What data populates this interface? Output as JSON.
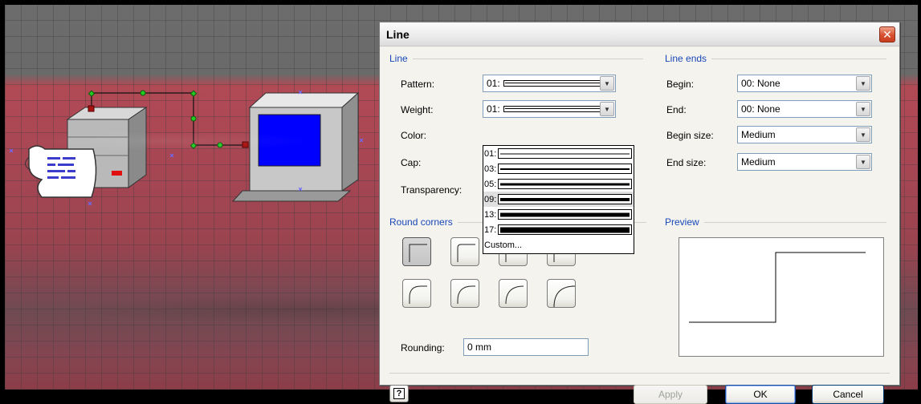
{
  "dialog": {
    "title": "Line",
    "line_group": {
      "title": "Line",
      "pattern_label": "Pattern:",
      "pattern_value": "01:",
      "weight_label": "Weight:",
      "weight_value": "01:",
      "color_label": "Color:",
      "cap_label": "Cap:",
      "transparency_label": "Transparency:"
    },
    "weight_dropdown": {
      "items": [
        {
          "label": "01:",
          "thickness": 1
        },
        {
          "label": "03:",
          "thickness": 2
        },
        {
          "label": "05:",
          "thickness": 3
        },
        {
          "label": "09:",
          "thickness": 4,
          "selected": true
        },
        {
          "label": "13:",
          "thickness": 5
        },
        {
          "label": "17:",
          "thickness": 7
        }
      ],
      "custom_label": "Custom..."
    },
    "line_ends": {
      "title": "Line ends",
      "begin_label": "Begin:",
      "begin_value": "00: None",
      "end_label": "End:",
      "end_value": "00: None",
      "begin_size_label": "Begin size:",
      "begin_size_value": "Medium",
      "end_size_label": "End size:",
      "end_size_value": "Medium"
    },
    "round_corners": {
      "title": "Round corners",
      "rounding_label": "Rounding:",
      "rounding_value": "0 mm"
    },
    "preview": {
      "title": "Preview"
    },
    "buttons": {
      "apply": "Apply",
      "ok": "OK",
      "cancel": "Cancel"
    }
  },
  "icons": {
    "close": "close-icon",
    "dropdown": "chevron-down-icon",
    "help": "help-icon"
  },
  "colors": {
    "group_title": "#1a48b8",
    "dialog_bg": "#f4f3ee",
    "close_button": "#d8502f",
    "monitor_screen": "#0000ff",
    "connector_handle": "#22cc22",
    "connector_endpoint": "#aa1111"
  }
}
